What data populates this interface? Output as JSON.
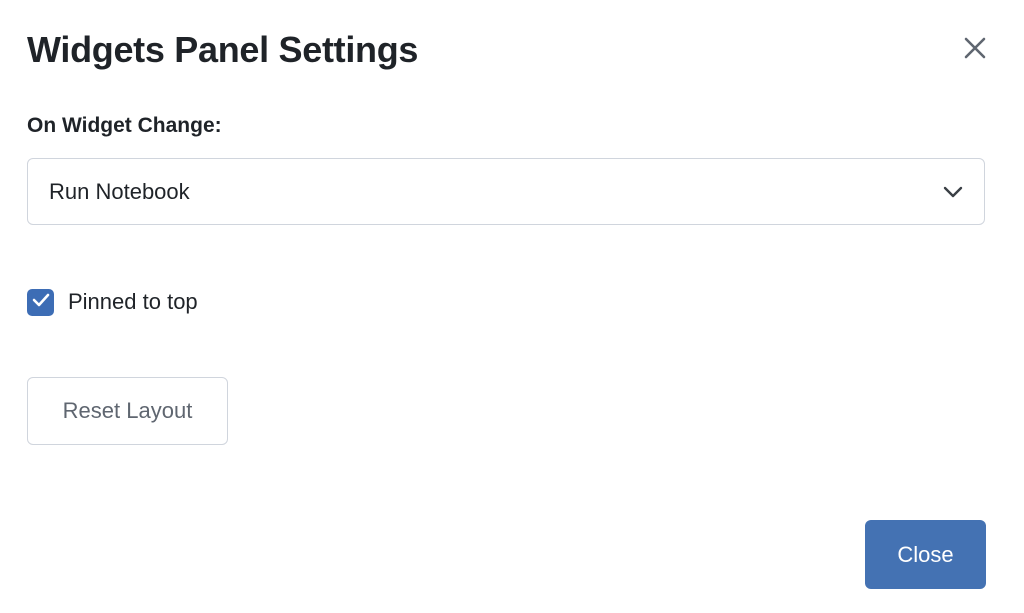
{
  "dialog": {
    "title": "Widgets Panel Settings",
    "close_icon": "close-icon"
  },
  "on_widget_change": {
    "label": "On Widget Change:",
    "selected_value": "Run Notebook",
    "chevron_icon": "chevron-down-icon"
  },
  "pinned": {
    "label": "Pinned to top",
    "checked": true,
    "check_icon": "check-icon"
  },
  "reset_button": {
    "label": "Reset Layout"
  },
  "footer": {
    "close_label": "Close"
  },
  "colors": {
    "primary": "#4472b3",
    "checkbox": "#3d6db5",
    "border": "#d0d5dd",
    "text": "#1f2328",
    "muted_text": "#5f6670"
  }
}
